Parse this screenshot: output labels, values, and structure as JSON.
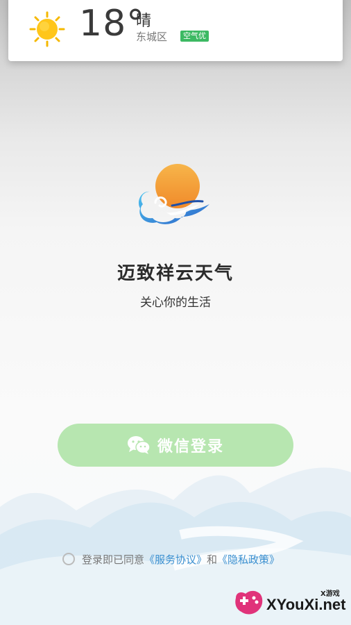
{
  "weather": {
    "icon": "sun-icon",
    "temperature": "18°",
    "condition": "晴",
    "district": "东城区",
    "aqi_badge": "空气优",
    "aqi_color": "#3cb963"
  },
  "app": {
    "logo_icon": "cloud-sun-logo-icon",
    "name": "迈致祥云天气",
    "slogan": "关心你的生活"
  },
  "login": {
    "wechat_icon": "wechat-icon",
    "wechat_label": "微信登录",
    "button_color": "#b7e6b0"
  },
  "agreement": {
    "prefix": "登录即已同意",
    "service_link": "《服务协议》",
    "conjunction": "和",
    "privacy_link": "《隐私政策》",
    "link_color": "#3a8fd0"
  },
  "watermark": {
    "small": "X游戏",
    "text": "XYouXi.net"
  }
}
